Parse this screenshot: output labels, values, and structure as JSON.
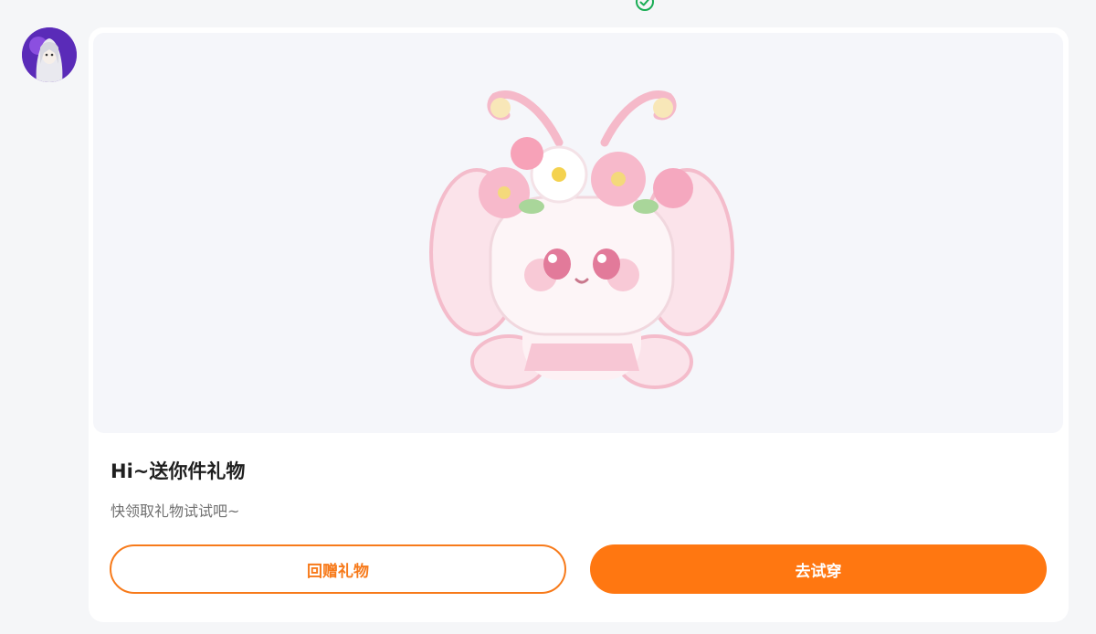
{
  "status": {
    "icon": "check-circle-icon",
    "color": "#1aad55"
  },
  "sender": {
    "avatar_icon": "avatar-white-hair-purple"
  },
  "gift": {
    "image_icon": "pink-butterfly-plush-with-flower-crown",
    "title": "Hi~送你件礼物",
    "subtitle": "快领取礼物试试吧~"
  },
  "actions": {
    "return_label": "回赠礼物",
    "try_label": "去试穿",
    "accent_color": "#ff7711"
  }
}
